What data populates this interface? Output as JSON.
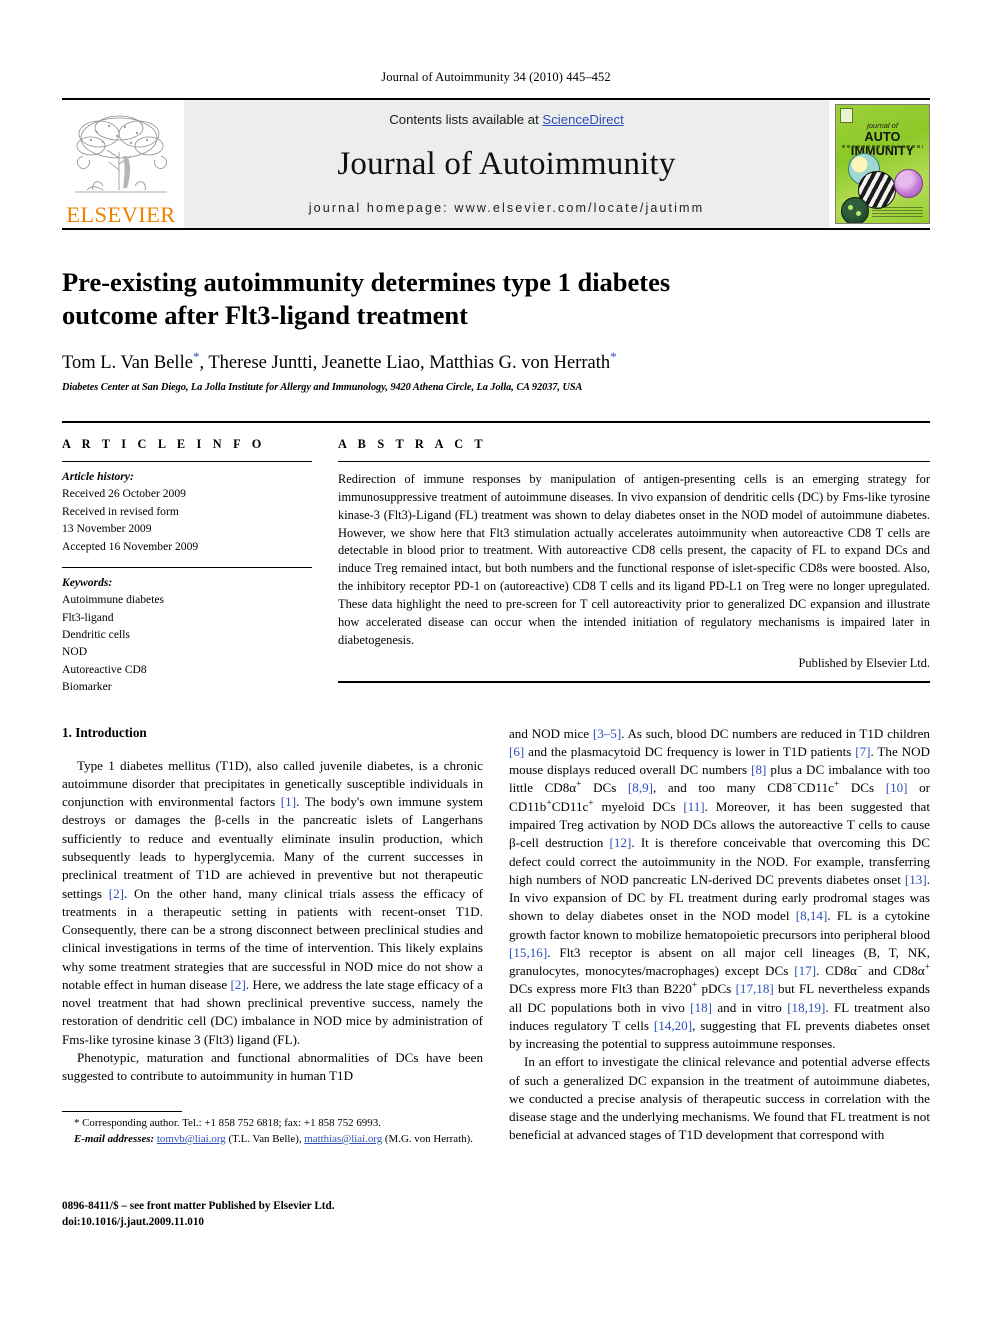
{
  "running_head": "Journal of Autoimmunity 34 (2010) 445–452",
  "masthead": {
    "publisher_name": "ELSEVIER",
    "contents_prefix": "Contents lists available at ",
    "sciencedirect": "ScienceDirect",
    "journal_title": "Journal of Autoimmunity",
    "homepage": "journal homepage: www.elsevier.com/locate/jautimm",
    "cover": {
      "line1": "journal of",
      "line2": "AUTO IMMUNITY"
    },
    "colors": {
      "elsevier_orange": "#F08000",
      "link_blue": "#2e4fb8",
      "banner_gray": "#eceded",
      "cover_green": "#8cc828"
    }
  },
  "article": {
    "title": "Pre-existing autoimmunity determines type 1 diabetes outcome after Flt3-ligand treatment",
    "authors": "Tom L. Van Belle*, Therese Juntti, Jeanette Liao, Matthias G. von Herrath*",
    "affiliation": "Diabetes Center at San Diego, La Jolla Institute for Allergy and Immunology, 9420 Athena Circle, La Jolla, CA 92037, USA"
  },
  "article_info": {
    "heading": "A R T I C L E   I N F O",
    "history_label": "Article history:",
    "history": [
      "Received 26 October 2009",
      "Received in revised form",
      "13 November 2009",
      "Accepted 16 November 2009"
    ],
    "keywords_label": "Keywords:",
    "keywords": [
      "Autoimmune diabetes",
      "Flt3-ligand",
      "Dendritic cells",
      "NOD",
      "Autoreactive CD8",
      "Biomarker"
    ]
  },
  "abstract": {
    "heading": "A B S T R A C T",
    "text": "Redirection of immune responses by manipulation of antigen-presenting cells is an emerging strategy for immunosuppressive treatment of autoimmune diseases. In vivo expansion of dendritic cells (DC) by Fms-like tyrosine kinase-3 (Flt3)-Ligand (FL) treatment was shown to delay diabetes onset in the NOD model of autoimmune diabetes. However, we show here that Flt3 stimulation actually accelerates autoimmunity when autoreactive CD8 T cells are detectable in blood prior to treatment. With autoreactive CD8 cells present, the capacity of FL to expand DCs and induce Treg remained intact, but both numbers and the functional response of islet-specific CD8s were boosted. Also, the inhibitory receptor PD-1 on (autoreactive) CD8 T cells and its ligand PD-L1 on Treg were no longer upregulated. These data highlight the need to pre-screen for T cell autoreactivity prior to generalized DC expansion and illustrate how accelerated disease can occur when the intended initiation of regulatory mechanisms is impaired later in diabetogenesis.",
    "published_by": "Published by Elsevier Ltd."
  },
  "introduction": {
    "section_number_title": "1. Introduction",
    "left_paragraphs": [
      "Type 1 diabetes mellitus (T1D), also called juvenile diabetes, is a chronic autoimmune disorder that precipitates in genetically susceptible individuals in conjunction with environmental factors [1]. The body's own immune system destroys or damages the β-cells in the pancreatic islets of Langerhans sufficiently to reduce and eventually eliminate insulin production, which subsequently leads to hyperglycemia. Many of the current successes in preclinical treatment of T1D are achieved in preventive but not therapeutic settings [2]. On the other hand, many clinical trials assess the efficacy of treatments in a therapeutic setting in patients with recent-onset T1D. Consequently, there can be a strong disconnect between preclinical studies and clinical investigations in terms of the time of intervention. This likely explains why some treatment strategies that are successful in NOD mice do not show a notable effect in human disease [2]. Here, we address the late stage efficacy of a novel treatment that had shown preclinical preventive success, namely the restoration of dendritic cell (DC) imbalance in NOD mice by administration of Fms-like tyrosine kinase 3 (Flt3) ligand (FL).",
      "Phenotypic, maturation and functional abnormalities of DCs have been suggested to contribute to autoimmunity in human T1D"
    ],
    "right_paragraphs": [
      "and NOD mice [3–5]. As such, blood DC numbers are reduced in T1D children [6] and the plasmacytoid DC frequency is lower in T1D patients [7]. The NOD mouse displays reduced overall DC numbers [8] plus a DC imbalance with too little CD8α+ DCs [8,9], and too many CD8−CD11c+ DCs [10] or CD11b+CD11c+ myeloid DCs [11]. Moreover, it has been suggested that impaired Treg activation by NOD DCs allows the autoreactive T cells to cause β-cell destruction [12]. It is therefore conceivable that overcoming this DC defect could correct the autoimmunity in the NOD. For example, transferring high numbers of NOD pancreatic LN-derived DC prevents diabetes onset [13]. In vivo expansion of DC by FL treatment during early prodromal stages was shown to delay diabetes onset in the NOD model [8,14]. FL is a cytokine growth factor known to mobilize hematopoietic precursors into peripheral blood [15,16]. Flt3 receptor is absent on all major cell lineages (B, T, NK, granulocytes, monocytes/macrophages) except DCs [17]. CD8α− and CD8α+ DCs express more Flt3 than B220+ pDCs [17,18] but FL nevertheless expands all DC populations both in vivo [18] and in vitro [18,19]. FL treatment also induces regulatory T cells [14,20], suggesting that FL prevents diabetes onset by increasing the potential to suppress autoimmune responses.",
      "In an effort to investigate the clinical relevance and potential adverse effects of such a generalized DC expansion in the treatment of autoimmune diabetes, we conducted a precise analysis of therapeutic success in correlation with the disease stage and the underlying mechanisms. We found that FL treatment is not beneficial at advanced stages of T1D development that correspond with"
    ]
  },
  "footnote": {
    "corresponding": "* Corresponding author. Tel.: +1 858 752 6818; fax: +1 858 752 6993.",
    "email_label": "E-mail addresses:",
    "email1": "tomvb@liai.org",
    "email1_owner": "(T.L. Van Belle),",
    "email2": "matthias@liai.org",
    "email2_owner": "(M.G. von Herrath)."
  },
  "page_footer": {
    "line1": "0896-8411/$ – see front matter Published by Elsevier Ltd.",
    "line2": "doi:10.1016/j.jaut.2009.11.010"
  }
}
